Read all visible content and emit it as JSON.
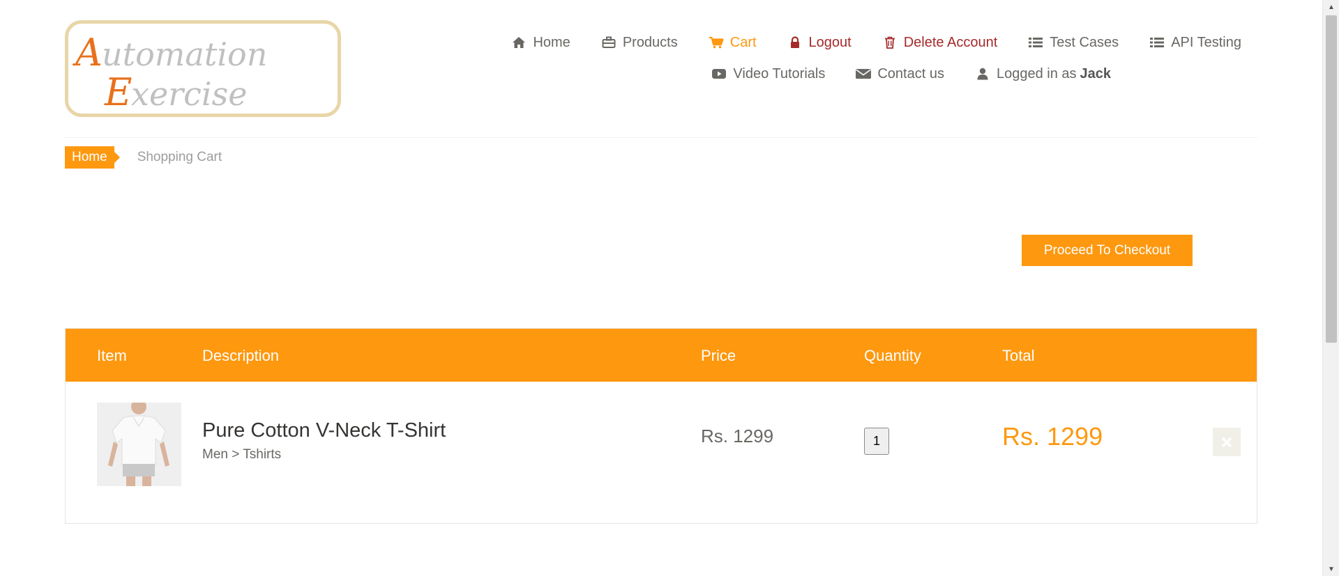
{
  "logo": {
    "line1": "Automation",
    "line2": "Exercise"
  },
  "nav": {
    "row1": [
      {
        "icon": "home-icon",
        "label": "Home"
      },
      {
        "icon": "briefcase-icon",
        "label": "Products"
      },
      {
        "icon": "cart-icon",
        "label": "Cart"
      },
      {
        "icon": "lock-icon",
        "label": "Logout"
      },
      {
        "icon": "trash-icon",
        "label": "Delete Account"
      },
      {
        "icon": "list-icon",
        "label": "Test Cases"
      },
      {
        "icon": "list-icon",
        "label": "API Testing"
      }
    ],
    "row2": [
      {
        "icon": "youtube-play-icon",
        "label": "Video Tutorials"
      },
      {
        "icon": "envelope-icon",
        "label": "Contact us"
      },
      {
        "icon": "user-icon",
        "label": "Logged in as",
        "user": "Jack"
      }
    ]
  },
  "breadcrumb": {
    "home": "Home",
    "current": "Shopping Cart"
  },
  "checkout": {
    "label": "Proceed To Checkout"
  },
  "cart": {
    "headers": {
      "item": "Item",
      "description": "Description",
      "price": "Price",
      "quantity": "Quantity",
      "total": "Total"
    },
    "rows": [
      {
        "name": "Pure Cotton V-Neck T-Shirt",
        "category": "Men > Tshirts",
        "price": "Rs. 1299",
        "quantity": "1",
        "total": "Rs. 1299"
      }
    ]
  },
  "colors": {
    "accent": "#FE980F",
    "danger": "#A52A2A",
    "text": "#696763"
  }
}
